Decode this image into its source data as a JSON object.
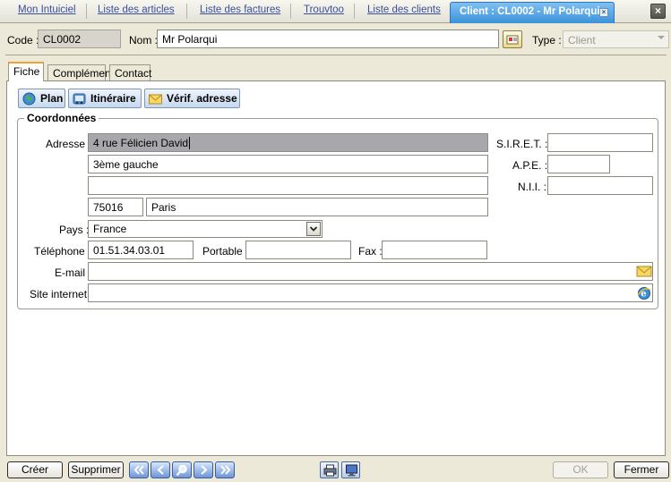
{
  "top_tabs": [
    {
      "label": "Mon Intuiciel"
    },
    {
      "label": "Liste des articles"
    },
    {
      "label": "Liste des factures"
    },
    {
      "label": "Trouvtoo"
    },
    {
      "label": "Liste des clients"
    }
  ],
  "active_tab": {
    "label": "Client : CL0002 - Mr Polarqui"
  },
  "header": {
    "code_label": "Code :",
    "code_value": "CL0002",
    "nom_label": "Nom :",
    "nom_value": "Mr Polarqui",
    "type_label": "Type :",
    "type_value": "Client"
  },
  "inner_tabs": [
    {
      "label": "Fiche"
    },
    {
      "label": "Complément"
    },
    {
      "label": "Contact"
    }
  ],
  "actions": {
    "plan": "Plan",
    "itineraire": "Itinéraire",
    "verif": "Vérif. adresse"
  },
  "coordonnees": {
    "title": "Coordonnées",
    "adresse_label": "Adresse :",
    "adresse1": "4 rue Félicien David",
    "adresse2": "3ème gauche",
    "adresse3": "",
    "cp": "75016",
    "ville": "Paris",
    "pays_label": "Pays :",
    "pays": "France",
    "tel_label": "Téléphone :",
    "tel": "01.51.34.03.01",
    "portable_label": "Portable :",
    "portable": "",
    "fax_label": "Fax :",
    "fax": "",
    "email_label": "E-mail :",
    "email": "",
    "site_label": "Site internet :",
    "site": "",
    "siret_label": "S.I.R.E.T. :",
    "siret": "",
    "ape_label": "A.P.E. :",
    "ape": "",
    "nii_label": "N.I.I. :",
    "nii": ""
  },
  "bottom": {
    "creer": "Créer",
    "supprimer": "Supprimer",
    "ok": "OK",
    "fermer": "Fermer"
  },
  "colors": {
    "active_tab": "#3c92d8",
    "tab_accent": "#f2a12f",
    "window_bg": "#ece9d8"
  }
}
